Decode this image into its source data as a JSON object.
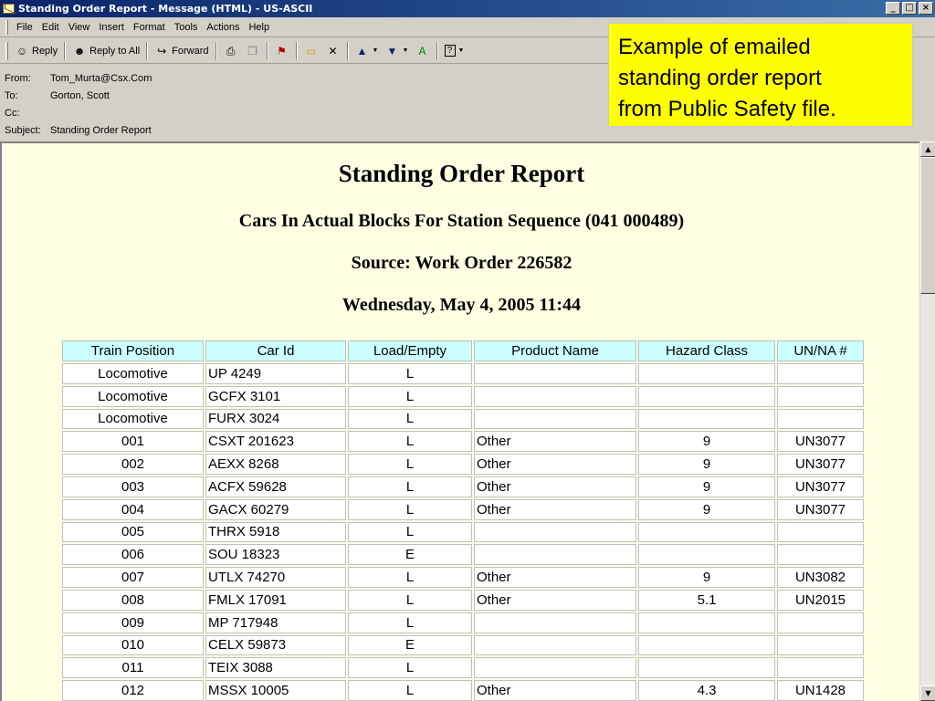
{
  "window": {
    "title": "Standing Order Report - Message (HTML)  - US-ASCII",
    "buttons": {
      "minimize": "_",
      "maximize": "□",
      "close": "×"
    }
  },
  "menu": [
    "File",
    "Edit",
    "View",
    "Insert",
    "Format",
    "Tools",
    "Actions",
    "Help"
  ],
  "toolbar": {
    "reply": "Reply",
    "reply_all": "Reply to All",
    "forward": "Forward"
  },
  "message": {
    "from_label": "From:",
    "from": "Tom_Murta@Csx.Com",
    "to_label": "To:",
    "to": "Gorton, Scott",
    "cc_label": "Cc:",
    "cc": "",
    "subject_label": "Subject:",
    "subject": "Standing Order Report"
  },
  "callout": {
    "line1": "Example of emailed",
    "line2": "standing order report",
    "line3": "from Public Safety file."
  },
  "report": {
    "title": "Standing Order Report",
    "subtitle": "Cars In Actual Blocks For Station Sequence (041 000489)",
    "source": "Source: Work Order 226582",
    "date": "Wednesday, May 4, 2005 11:44",
    "columns": [
      "Train Position",
      "Car Id",
      "Load/Empty",
      "Product Name",
      "Hazard Class",
      "UN/NA #"
    ],
    "rows": [
      [
        "Locomotive",
        "UP 4249",
        "L",
        "",
        "",
        ""
      ],
      [
        "Locomotive",
        "GCFX 3101",
        "L",
        "",
        "",
        ""
      ],
      [
        "Locomotive",
        "FURX 3024",
        "L",
        "",
        "",
        ""
      ],
      [
        "001",
        "CSXT 201623",
        "L",
        "Other",
        "9",
        "UN3077"
      ],
      [
        "002",
        "AEXX 8268",
        "L",
        "Other",
        "9",
        "UN3077"
      ],
      [
        "003",
        "ACFX 59628",
        "L",
        "Other",
        "9",
        "UN3077"
      ],
      [
        "004",
        "GACX 60279",
        "L",
        "Other",
        "9",
        "UN3077"
      ],
      [
        "005",
        "THRX 5918",
        "L",
        "",
        "",
        ""
      ],
      [
        "006",
        "SOU 18323",
        "E",
        "",
        "",
        ""
      ],
      [
        "007",
        "UTLX 74270",
        "L",
        "Other",
        "9",
        "UN3082"
      ],
      [
        "008",
        "FMLX 17091",
        "L",
        "Other",
        "5.1",
        "UN2015"
      ],
      [
        "009",
        "MP 717948",
        "L",
        "",
        "",
        ""
      ],
      [
        "010",
        "CELX 59873",
        "E",
        "",
        "",
        ""
      ],
      [
        "011",
        "TEIX 3088",
        "L",
        "",
        "",
        ""
      ],
      [
        "012",
        "MSSX 10005",
        "L",
        "Other",
        "4.3",
        "UN1428"
      ]
    ]
  }
}
